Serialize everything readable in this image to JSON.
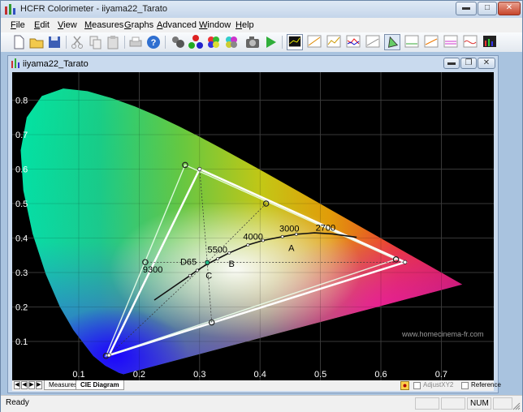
{
  "window": {
    "title": "HCFR Colorimeter - iiyama22_Tarato"
  },
  "menu": [
    "File",
    "Edit",
    "View",
    "Measures",
    "Graphs",
    "Advanced",
    "Window",
    "Help"
  ],
  "document": {
    "title": "iiyama22_Tarato"
  },
  "tabs": {
    "measures": "Measures",
    "cie": "CIE Diagram"
  },
  "options": {
    "adjust": "AdjustXY2",
    "reference": "Reference"
  },
  "status": {
    "text": "Ready",
    "num": "NUM"
  },
  "watermark": "www.homecinema-fr.com",
  "chart_data": {
    "type": "scatter",
    "title": "",
    "xlim": [
      0.05,
      0.8
    ],
    "ylim": [
      0.0,
      0.9
    ],
    "x_ticks": [
      "0.1",
      "0.2",
      "0.3",
      "0.4",
      "0.5",
      "0.6",
      "0.7"
    ],
    "y_ticks": [
      "0.1",
      "0.2",
      "0.3",
      "0.4",
      "0.5",
      "0.6",
      "0.7",
      "0.8"
    ],
    "target_gamut": [
      [
        0.64,
        0.33
      ],
      [
        0.3,
        0.6
      ],
      [
        0.15,
        0.06
      ]
    ],
    "measured_gamut": [
      [
        0.625,
        0.338
      ],
      [
        0.276,
        0.612
      ],
      [
        0.145,
        0.058
      ]
    ],
    "secondaries": [
      [
        0.21,
        0.33
      ],
      [
        0.41,
        0.5
      ],
      [
        0.32,
        0.155
      ]
    ],
    "planckian_locus": [
      [
        0.225,
        0.22
      ],
      [
        0.264,
        0.267
      ],
      [
        0.284,
        0.291
      ],
      [
        0.296,
        0.306
      ],
      [
        0.313,
        0.325
      ],
      [
        0.33,
        0.34
      ],
      [
        0.349,
        0.357
      ],
      [
        0.38,
        0.38
      ],
      [
        0.405,
        0.393
      ],
      [
        0.437,
        0.404
      ],
      [
        0.46,
        0.411
      ],
      [
        0.49,
        0.415
      ],
      [
        0.52,
        0.412
      ],
      [
        0.56,
        0.402
      ]
    ],
    "locus_labels": [
      {
        "text": "9300",
        "x": 0.206,
        "y": 0.3
      },
      {
        "text": "D65",
        "x": 0.268,
        "y": 0.322
      },
      {
        "text": "5500",
        "x": 0.313,
        "y": 0.358
      },
      {
        "text": "4000",
        "x": 0.372,
        "y": 0.395
      },
      {
        "text": "3000",
        "x": 0.432,
        "y": 0.419
      },
      {
        "text": "2700",
        "x": 0.492,
        "y": 0.421
      }
    ],
    "illuminant_labels": [
      {
        "text": "A",
        "x": 0.447,
        "y": 0.362
      },
      {
        "text": "B",
        "x": 0.348,
        "y": 0.317
      },
      {
        "text": "C",
        "x": 0.31,
        "y": 0.282
      }
    ],
    "white_point": [
      0.3127,
      0.329
    ],
    "grid": true
  }
}
